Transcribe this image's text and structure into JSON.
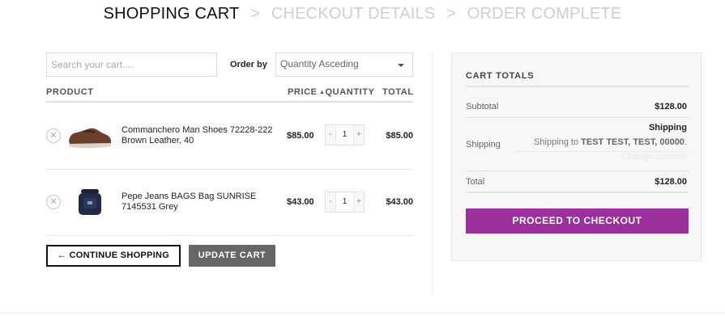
{
  "steps": {
    "active": "SHOPPING CART",
    "separator": ">",
    "checkout": "CHECKOUT DETAILS",
    "complete": "ORDER COMPLETE"
  },
  "search": {
    "placeholder": "Search your cart...."
  },
  "order_by": {
    "label": "Order by",
    "selected": "Quantity Asceding"
  },
  "table": {
    "headers": {
      "product": "PRODUCT",
      "price": "PRICE",
      "sort_icon": "▲",
      "quantity": "QUANTITY",
      "total": "TOTAL"
    },
    "rows": [
      {
        "remove": "✕",
        "name": "Commanchero Man Shoes 72228-222 Brown Leather, 40",
        "price": "$85.00",
        "qty_minus": "-",
        "qty": "1",
        "qty_plus": "+",
        "total": "$85.00"
      },
      {
        "remove": "✕",
        "name": "Pepe Jeans BAGS Bag SUNRISE 7145531 Grey",
        "price": "$43.00",
        "qty_minus": "-",
        "qty": "1",
        "qty_plus": "+",
        "total": "$43.00"
      }
    ]
  },
  "buttons": {
    "continue": "← CONTINUE SHOPPING",
    "update": "UPDATE CART",
    "checkout": "PROCEED TO CHECKOUT"
  },
  "cart_totals": {
    "title": "CART TOTALS",
    "subtotal_label": "Subtotal",
    "subtotal_value": "$128.00",
    "shipping_label": "Shipping",
    "shipping_heading": "Shipping",
    "shipping_to_prefix": "Shipping to",
    "shipping_address": "TEST TEST, TEST, 00000",
    "shipping_suffix": ".",
    "change_address": "Change address",
    "total_label": "Total",
    "total_value": "$128.00"
  },
  "colors": {
    "accent": "#9b2f9b",
    "update_button": "#666666"
  },
  "icons": {
    "remove": "close-circle-icon",
    "sort": "sort-up-icon",
    "dropdown": "chevron-down-icon"
  }
}
